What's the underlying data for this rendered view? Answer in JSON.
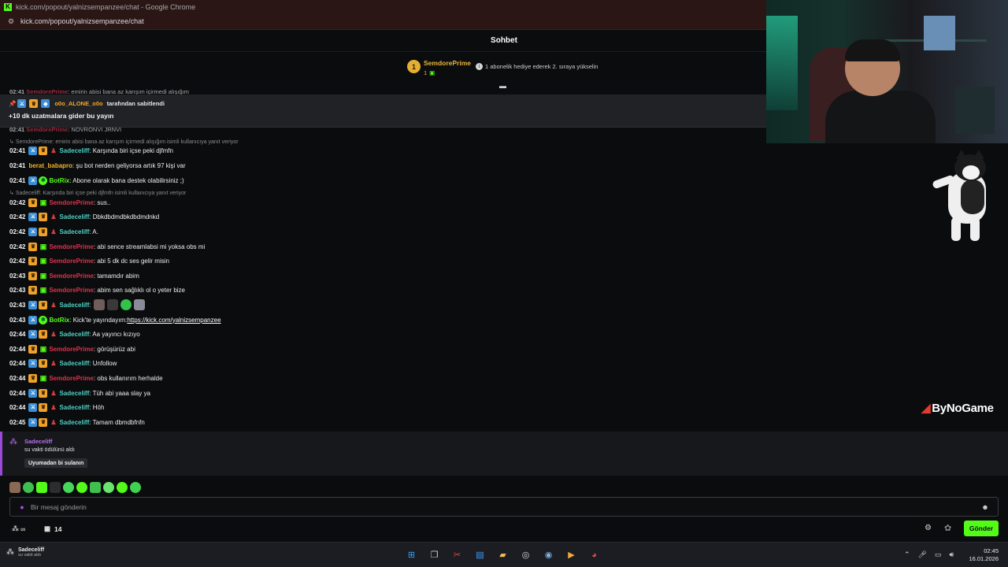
{
  "browser": {
    "window_title": "kick.com/popout/yalnizsempanzee/chat - Google Chrome",
    "url": "kick.com/popout/yalnizsempanzee/chat"
  },
  "chat": {
    "header_title": "Sohbet",
    "leaderboard": {
      "rank": "1",
      "name": "SemdorePrime",
      "count": "1",
      "hint": "1 abonelik hediye ederek 2. sıraya yükselin"
    },
    "pinned": {
      "author": "o0o_ALONE_o0o",
      "suffix": "tarafından sabitlendi",
      "message": "+10 dk uzatmalara gider bu yayın"
    },
    "clipped_top_text": "emirin abisi bana az karışım içirmedi alışığım",
    "clipped_mid_text": "NOVRONVI JRNVI",
    "reply_1": "SemdorePrime: emirin abisi bana az karışım içirmedi alışığım isimli kullanıcıya yanıt veriyor",
    "reply_2": "Sadeceliff: Karşında biri içse peki djfmfn isimli kullanıcıya yanıt veriyor",
    "messages": [
      {
        "time": "02:41",
        "user": "Sadeceliff",
        "text": ": Karşında biri içse peki djfmfn"
      },
      {
        "time": "02:41",
        "user": "berat_babapro",
        "text": ": şu bot nerden geliyorsa artık 97 kişi var"
      },
      {
        "time": "02:41",
        "user": "BotRix",
        "text": ": Abone olarak bana destek olabilirsiniz ;)"
      },
      {
        "time": "02:42",
        "user": "SemdorePrime",
        "text": ": sus.."
      },
      {
        "time": "02:42",
        "user": "Sadeceliff",
        "text": ": Dbkdbdmdbkdbdmdnkd"
      },
      {
        "time": "02:42",
        "user": "Sadeceliff",
        "text": ": A."
      },
      {
        "time": "02:42",
        "user": "SemdorePrime",
        "text": ": abi sence streamlabsi mi yoksa obs mi"
      },
      {
        "time": "02:42",
        "user": "SemdorePrime",
        "text": ": abi 5 dk dc ses gelir misin"
      },
      {
        "time": "02:43",
        "user": "SemdorePrime",
        "text": ": tamamdır abim"
      },
      {
        "time": "02:43",
        "user": "SemdorePrime",
        "text": ": abim sen sağlıklı ol o yeter bize"
      },
      {
        "time": "02:43",
        "user": "Sadeceliff",
        "text": ":"
      },
      {
        "time": "02:43",
        "user": "BotRix",
        "text": ": Kick'te yayındayım: ",
        "link": "https://kick.com/yalnizsempanzee"
      },
      {
        "time": "02:44",
        "user": "Sadeceliff",
        "text": ": Aa yayıncı kızıyo"
      },
      {
        "time": "02:44",
        "user": "SemdorePrime",
        "text": ": görüşürüz abi"
      },
      {
        "time": "02:44",
        "user": "Sadeceliff",
        "text": ": Unfollow"
      },
      {
        "time": "02:44",
        "user": "SemdorePrime",
        "text": ": obs kullanırım herhalde"
      },
      {
        "time": "02:44",
        "user": "Sadeceliff",
        "text": ": Tüh abi yaaa slay ya"
      },
      {
        "time": "02:44",
        "user": "Sadeceliff",
        "text": ": Höh"
      },
      {
        "time": "02:45",
        "user": "Sadeceliff",
        "text": ": Tamam dbmdbfnfn"
      }
    ],
    "reward": {
      "user": "Sadeceliff",
      "text": "su vakti ödülünü aldı",
      "button": "Uyumadan bi sulanın"
    },
    "input_placeholder": "Bir mesaj gönderin",
    "points_value": "∞",
    "chests_count": "14",
    "send_label": "Gönder"
  },
  "overlay": {
    "watermark": "ByNoGame"
  },
  "taskbar": {
    "widget_user": "Sadeceliff",
    "widget_sub": "su vakti aldı",
    "time": "02:45",
    "date": "16.01.2026"
  },
  "colors": {
    "kick_green": "#53fc18",
    "semdore_red": "#e0324b",
    "sadeceliff_teal": "#4fd1c5",
    "berat_yellow": "#f0b429",
    "botrix_green": "#53fc18",
    "reward_purple": "#9b4ad8"
  },
  "icons": [
    "kick-favicon",
    "site-info-icon",
    "pin-icon",
    "moderator-badge-icon",
    "vip-badge-icon",
    "subscriber-badge-icon",
    "bot-badge-icon",
    "reply-icon",
    "mic-icon",
    "emoji-icon",
    "settings-icon",
    "gift-icon",
    "points-icon",
    "chest-icon"
  ]
}
